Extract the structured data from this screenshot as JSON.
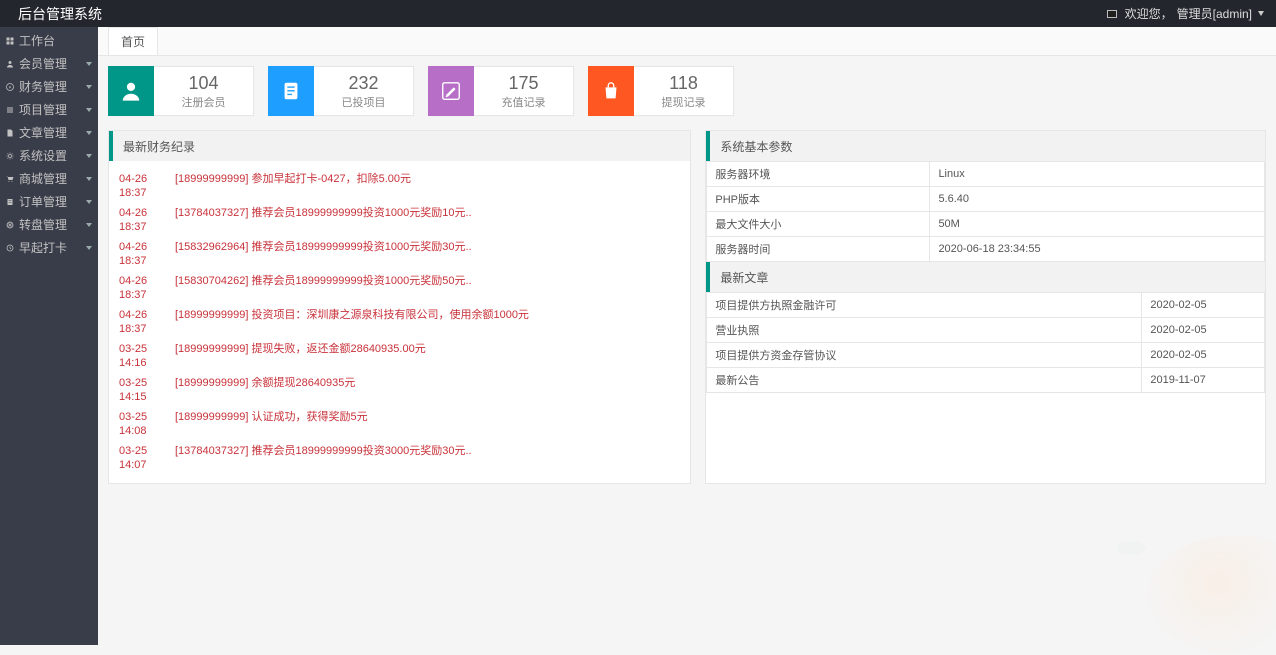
{
  "topbar": {
    "title": "后台管理系统",
    "welcome_prefix": "欢迎您，",
    "role_user": "管理员[admin]"
  },
  "sidebar": {
    "items": [
      {
        "label": "工作台",
        "icon": "dashboard",
        "expandable": false
      },
      {
        "label": "会员管理",
        "icon": "user",
        "expandable": true
      },
      {
        "label": "财务管理",
        "icon": "money",
        "expandable": true
      },
      {
        "label": "项目管理",
        "icon": "list",
        "expandable": true
      },
      {
        "label": "文章管理",
        "icon": "doc",
        "expandable": true
      },
      {
        "label": "系统设置",
        "icon": "gear",
        "expandable": true
      },
      {
        "label": "商城管理",
        "icon": "cart",
        "expandable": true
      },
      {
        "label": "订单管理",
        "icon": "order",
        "expandable": true
      },
      {
        "label": "转盘管理",
        "icon": "wheel",
        "expandable": true
      },
      {
        "label": "早起打卡",
        "icon": "clock",
        "expandable": true
      }
    ]
  },
  "tabs": {
    "home": "首页"
  },
  "stats": [
    {
      "value": "104",
      "label": "注册会员",
      "color": "green",
      "icon": "user"
    },
    {
      "value": "232",
      "label": "已投项目",
      "color": "blue",
      "icon": "clipboard"
    },
    {
      "value": "175",
      "label": "充值记录",
      "color": "pink",
      "icon": "edit"
    },
    {
      "value": "118",
      "label": "提现记录",
      "color": "orange",
      "icon": "bag"
    }
  ],
  "records": {
    "title": "最新财务纪录",
    "rows": [
      {
        "time": "04-26 18:37",
        "text": "[18999999999] 参加早起打卡-0427，扣除5.00元"
      },
      {
        "time": "04-26 18:37",
        "text": "[13784037327] 推荐会员18999999999投资1000元奖励10元.."
      },
      {
        "time": "04-26 18:37",
        "text": "[15832962964] 推荐会员18999999999投资1000元奖励30元.."
      },
      {
        "time": "04-26 18:37",
        "text": "[15830704262] 推荐会员18999999999投资1000元奖励50元.."
      },
      {
        "time": "04-26 18:37",
        "text": "[18999999999] 投资项目：深圳康之源泉科技有限公司，使用余额1000元"
      },
      {
        "time": "03-25 14:16",
        "text": "[18999999999] 提现失败，返还金额28640935.00元"
      },
      {
        "time": "03-25 14:15",
        "text": "[18999999999] 余额提现28640935元"
      },
      {
        "time": "03-25 14:08",
        "text": "[18999999999] 认证成功，获得奖励5元"
      },
      {
        "time": "03-25 14:07",
        "text": "[13784037327] 推荐会员18999999999投资3000元奖励30元.."
      }
    ]
  },
  "params": {
    "title": "系统基本参数",
    "rows": [
      {
        "k": "服务器环境",
        "v": "Linux"
      },
      {
        "k": "PHP版本",
        "v": "5.6.40"
      },
      {
        "k": "最大文件大小",
        "v": "50M"
      },
      {
        "k": "服务器时间",
        "v": "2020-06-18 23:34:55"
      }
    ]
  },
  "articles": {
    "title": "最新文章",
    "rows": [
      {
        "t": "项目提供方执照金融许可",
        "d": "2020-02-05"
      },
      {
        "t": "营业执照",
        "d": "2020-02-05"
      },
      {
        "t": "项目提供方资金存管协议",
        "d": "2020-02-05"
      },
      {
        "t": "最新公告",
        "d": "2019-11-07"
      }
    ]
  }
}
